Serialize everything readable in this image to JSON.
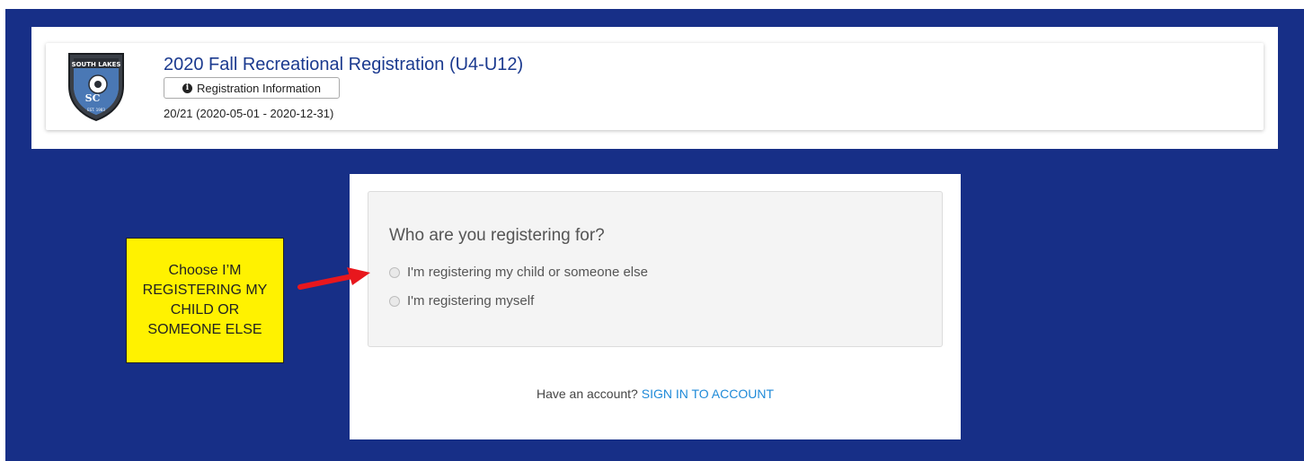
{
  "header": {
    "title": "2020 Fall Recreational Registration (U4-U12)",
    "info_button_label": "Registration Information",
    "date_range": "20/21 (2020-05-01 - 2020-12-31)",
    "logo_text_top": "SOUTH LAKES",
    "logo_text_mid": "SC",
    "logo_text_bottom": "EST. 1983"
  },
  "form": {
    "question": "Who are you registering for?",
    "options": [
      {
        "label": "I'm registering my child or someone else",
        "selected": false
      },
      {
        "label": "I'm registering myself",
        "selected": false
      }
    ],
    "account_prompt": "Have an account?",
    "signin_link": "SIGN IN TO ACCOUNT"
  },
  "annotation": {
    "text": "Choose I’M REGISTERING MY CHILD OR SOMEONE ELSE"
  },
  "colors": {
    "background": "#172f87",
    "title": "#1b3a8f",
    "link": "#1f8ad8",
    "callout": "#fff200",
    "arrow": "#e8171d"
  }
}
